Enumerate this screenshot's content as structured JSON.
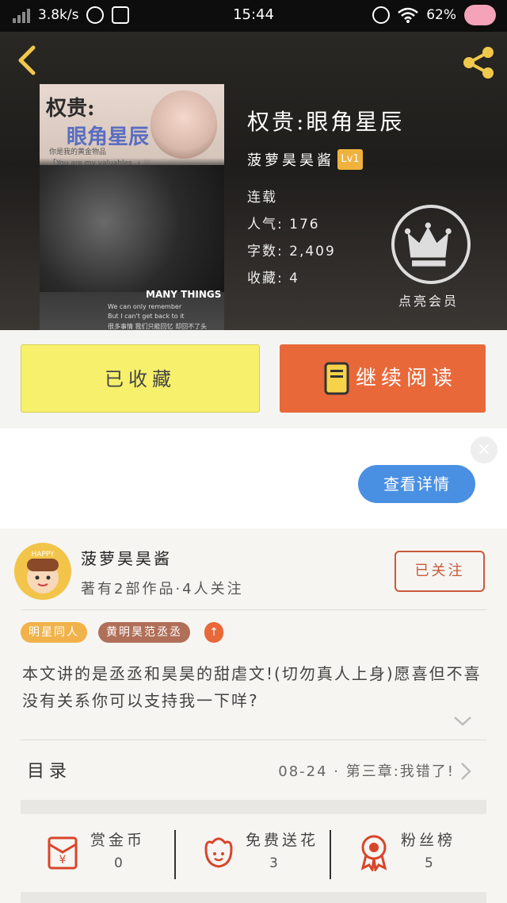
{
  "status_bar": {
    "speed": "3.8k/s",
    "time": "15:44",
    "battery": "62%"
  },
  "book": {
    "title": "权贵:眼角星辰",
    "author": "菠萝昊昊酱",
    "level": "Lv1",
    "status": "连载",
    "popularity": "人气: 176",
    "words": "字数: 2,409",
    "favorites": "收藏: 4",
    "vip_label": "点亮会员"
  },
  "cover": {
    "title_a": "权贵:",
    "title_b": "眼角星辰",
    "sub1": "你是我的黄金物品",
    "sub2": "「You are my valuables .」♡",
    "mt": "MANY THINGS",
    "en1": "We can only remember",
    "en2": "But I can't get back to it",
    "cn": "很多事情 我们只能回忆 却回不了头"
  },
  "actions": {
    "collected": "已收藏",
    "continue_read": "继续阅读"
  },
  "ad": {
    "close": "×",
    "detail_button": "查看详情"
  },
  "author_card": {
    "name": "菠萝昊昊酱",
    "meta": "著有2部作品·4人关注",
    "follow": "已关注",
    "avatar_text": "HAPPY",
    "tags": [
      "明星同人",
      "黄明昊范丞丞",
      "↑"
    ],
    "description": "本文讲的是丞丞和昊昊的甜虐文!(切勿真人上身)愿喜但不喜没有关系你可以支持我一下咩?",
    "toc_label": "目录",
    "toc_latest": "08-24 · 第三章:我错了!"
  },
  "stats": [
    {
      "label": "赏金币",
      "value": "0",
      "icon": "red-envelope-icon"
    },
    {
      "label": "免费送花",
      "value": "3",
      "icon": "flower-icon"
    },
    {
      "label": "粉丝榜",
      "value": "5",
      "icon": "medal-icon"
    }
  ],
  "colors": {
    "accent_orange": "#e8683a",
    "collected_yellow": "#f7f06c",
    "badge_gold": "#f0b23d",
    "ad_blue": "#4a90e2",
    "follow_red": "#c95a3a"
  }
}
